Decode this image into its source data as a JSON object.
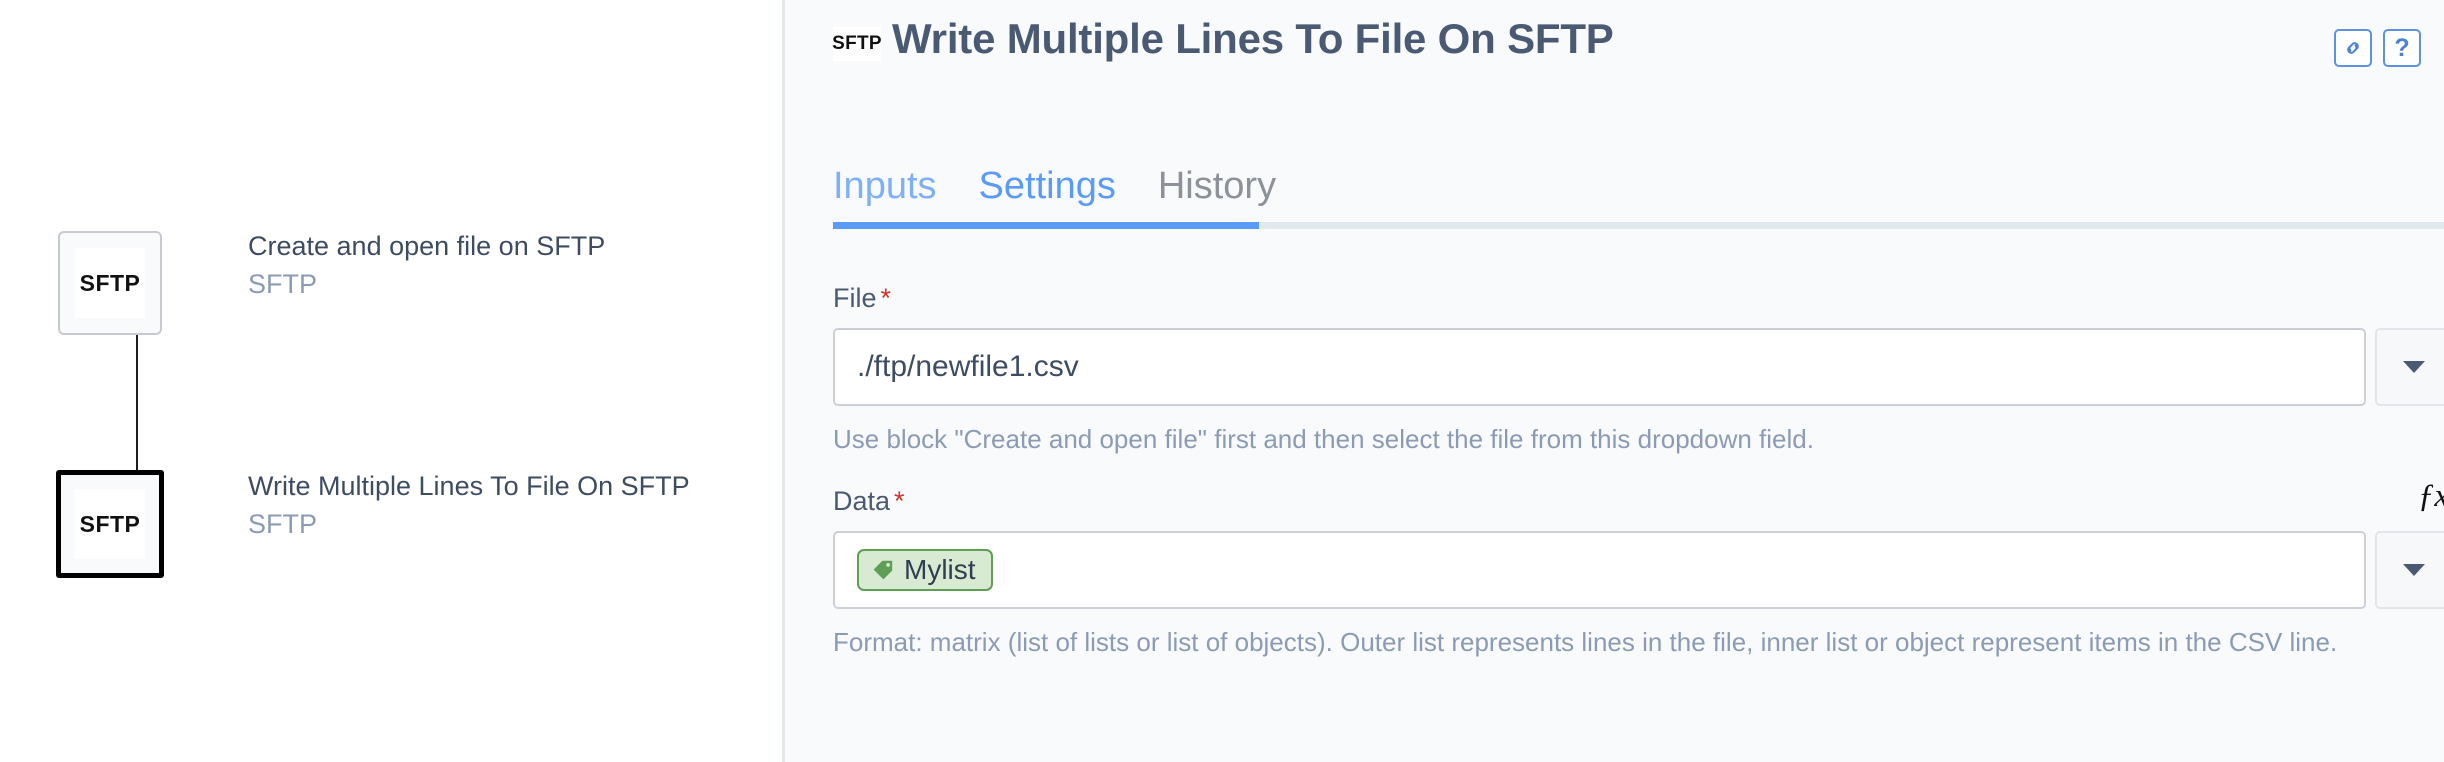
{
  "canvas": {
    "nodes": [
      {
        "id": "node-1",
        "logo": "SFTP",
        "title": "Create and open file on SFTP",
        "subtitle": "SFTP",
        "selected": false
      },
      {
        "id": "node-2",
        "logo": "SFTP",
        "title": "Write Multiple Lines To File On SFTP",
        "subtitle": "SFTP",
        "selected": true
      }
    ]
  },
  "header": {
    "icon_label": "SFTP",
    "title": "Write Multiple Lines To File On SFTP",
    "actions": [
      {
        "name": "link-icon",
        "label": ""
      },
      {
        "name": "help-icon",
        "label": "?"
      }
    ]
  },
  "tabs": [
    {
      "label": "Inputs",
      "state": "active"
    },
    {
      "label": "Settings",
      "state": "current"
    },
    {
      "label": "History",
      "state": "inactive"
    }
  ],
  "form": {
    "file": {
      "label": "File",
      "required_marker": "*",
      "value": "./ftp/newfile1.csv",
      "placeholder": "",
      "helper": "Use block \"Create and open file\" first and then select the file from this dropdown field."
    },
    "data": {
      "label": "Data",
      "required_marker": "*",
      "fx_label": "ƒx",
      "chip": {
        "icon": "tag-icon",
        "text": "Mylist"
      },
      "helper": "Format: matrix (list of lists or list of objects). Outer list represents lines in the file, inner list or object represent items in the CSV line."
    }
  },
  "colors": {
    "accent": "#5b9bf8",
    "title": "#4a5a73",
    "helper": "#8c9bb5",
    "required": "#d0342c",
    "chip_bg": "#d9ead3",
    "chip_border": "#5e9e55",
    "panel_bg": "#f9fafb"
  }
}
